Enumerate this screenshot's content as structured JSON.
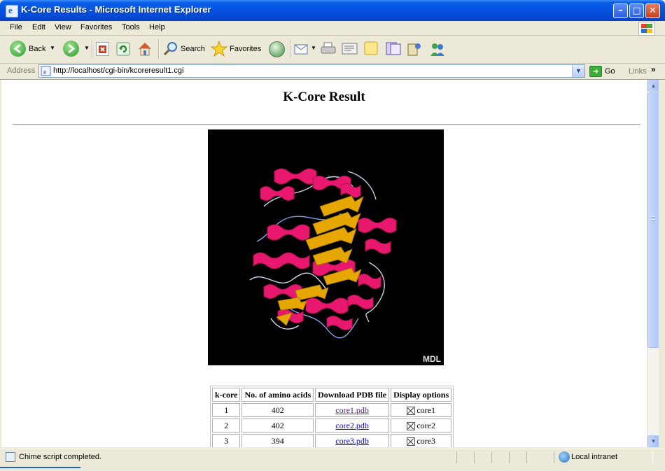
{
  "window": {
    "title": "K-Core Results - Microsoft Internet Explorer",
    "minimize_glyph": "–",
    "maximize_glyph": "□",
    "close_glyph": "✕"
  },
  "menu": {
    "items": [
      "File",
      "Edit",
      "View",
      "Favorites",
      "Tools",
      "Help"
    ]
  },
  "toolbar": {
    "back_label": "Back",
    "search_label": "Search",
    "favorites_label": "Favorites"
  },
  "address": {
    "label": "Address",
    "url": "http://localhost/cgi-bin/kcoreresult1.cgi",
    "go_label": "Go",
    "links_label": "Links",
    "links_chevron": "»"
  },
  "page": {
    "heading": "K-Core Result",
    "viewer_watermark": "MDL",
    "table": {
      "headers": [
        "k-core",
        "No. of amino acids",
        "Download PDB file",
        "Display options"
      ],
      "rows": [
        {
          "k": "1",
          "amino_acids": "402",
          "file": "core1.pdb",
          "option": "core1"
        },
        {
          "k": "2",
          "amino_acids": "402",
          "file": "core2.pdb",
          "option": "core2"
        },
        {
          "k": "3",
          "amino_acids": "394",
          "file": "core3.pdb",
          "option": "core3"
        }
      ]
    }
  },
  "status": {
    "text": "Chime script completed.",
    "zone": "Local intranet"
  },
  "colors": {
    "title_bar": "#0553e1",
    "helix": "#e8186e",
    "sheet": "#e6a800",
    "link": "#0000ee",
    "visited_link": "#551a8b"
  }
}
